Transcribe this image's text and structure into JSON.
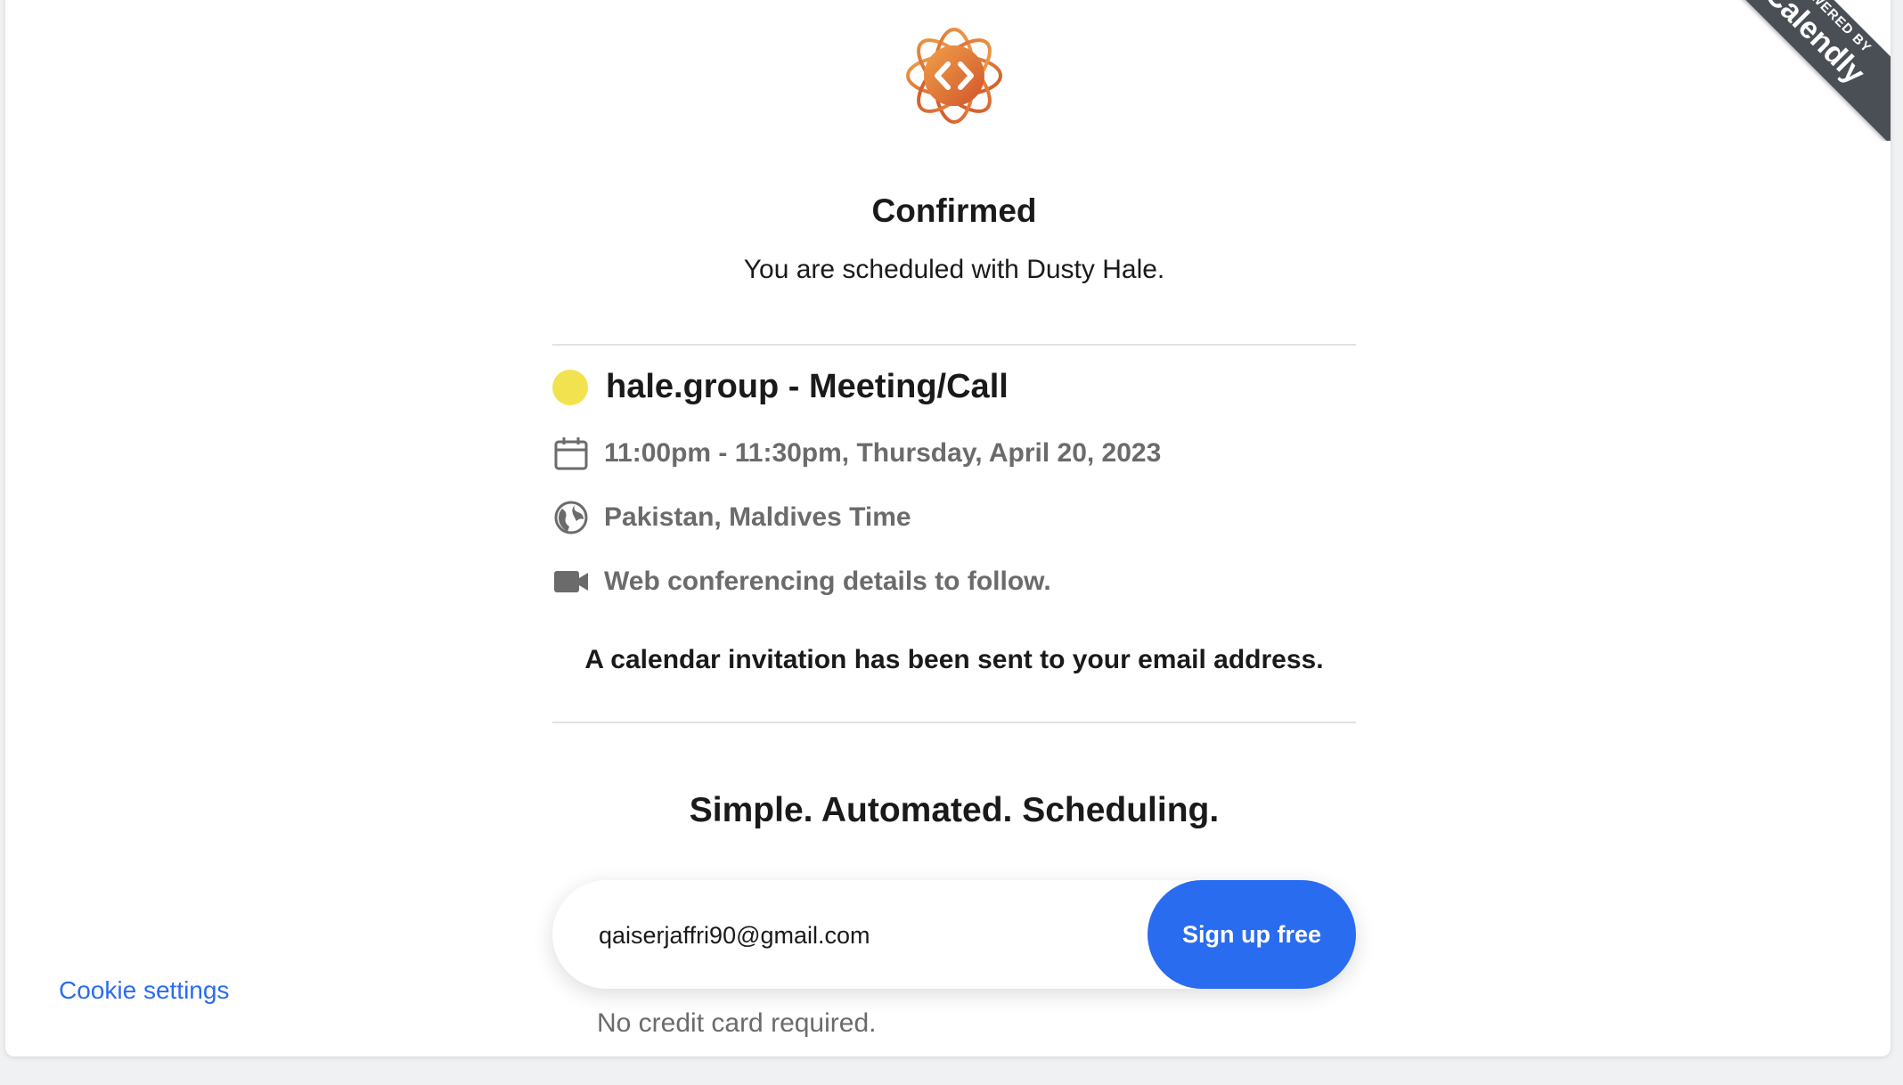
{
  "branding": {
    "ribbon_small": "POWERED BY",
    "ribbon_big": "Calendly"
  },
  "confirmation": {
    "title": "Confirmed",
    "subtitle": "You are scheduled with Dusty Hale."
  },
  "event": {
    "name": "hale.group - Meeting/Call",
    "color": "#f3e24f",
    "datetime": "11:00pm - 11:30pm, Thursday, April 20, 2023",
    "timezone": "Pakistan, Maldives Time",
    "conferencing": "Web conferencing details to follow.",
    "invite_note": "A calendar invitation has been sent to your email address."
  },
  "promo": {
    "tagline": "Simple. Automated. Scheduling.",
    "email_value": "qaiserjaffri90@gmail.com",
    "signup_label": "Sign up free",
    "no_cc": "No credit card required."
  },
  "footer": {
    "cookie_settings": "Cookie settings"
  },
  "colors": {
    "accent": "#2a6cf0",
    "ribbon": "#4a4f55",
    "logo": "#e07a2f"
  }
}
